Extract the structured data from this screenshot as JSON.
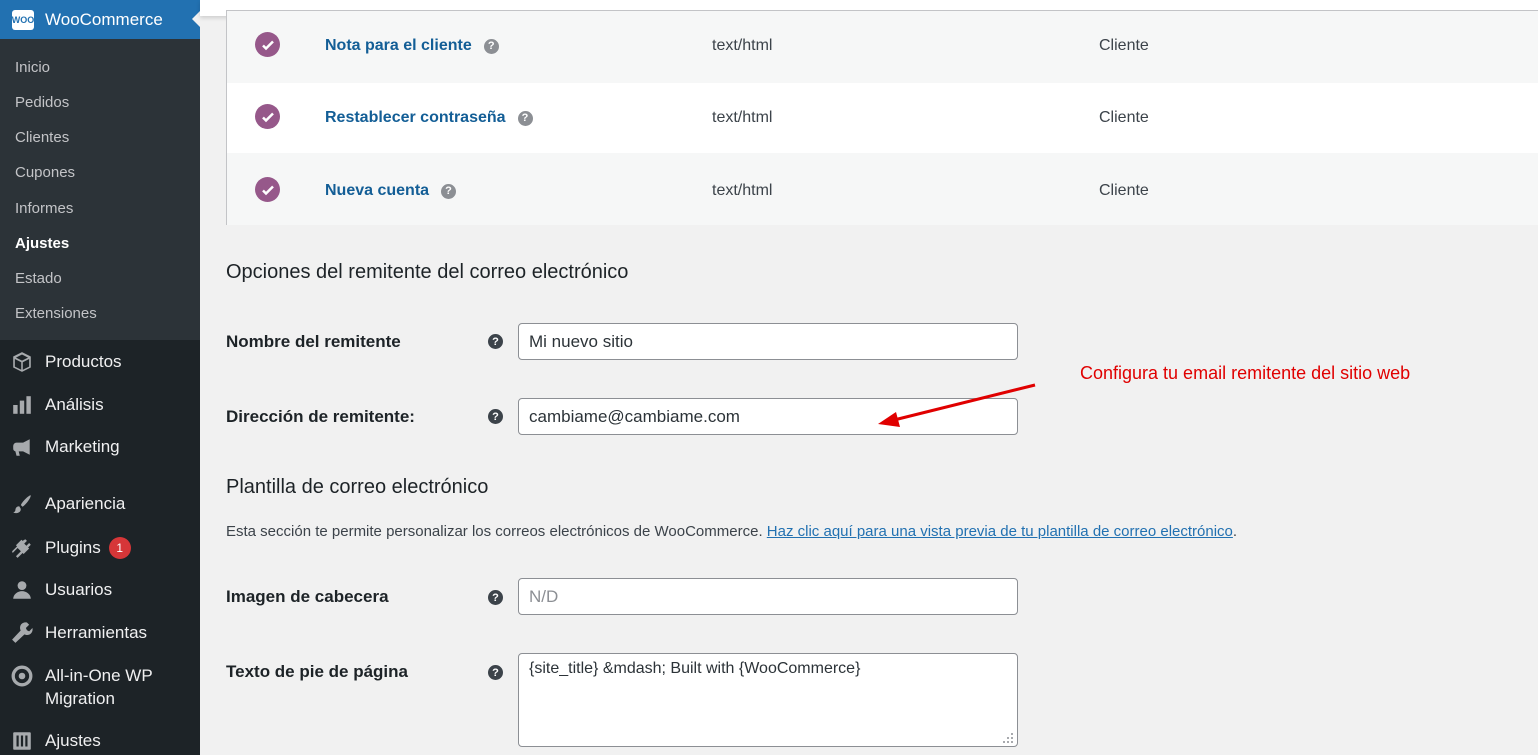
{
  "sidebar": {
    "woo_logo": "WOO",
    "woo_title": "WooCommerce",
    "submenu": [
      "Inicio",
      "Pedidos",
      "Clientes",
      "Cupones",
      "Informes",
      "Ajustes",
      "Estado",
      "Extensiones"
    ],
    "active_submenu": "Ajustes",
    "menu": [
      {
        "label": "Productos",
        "icon": "box-icon"
      },
      {
        "label": "Análisis",
        "icon": "bar-chart-icon"
      },
      {
        "label": "Marketing",
        "icon": "megaphone-icon"
      },
      {
        "label": "Apariencia",
        "icon": "paintbrush-icon"
      },
      {
        "label": "Plugins",
        "icon": "plug-icon",
        "badge": "1"
      },
      {
        "label": "Usuarios",
        "icon": "user-icon"
      },
      {
        "label": "Herramientas",
        "icon": "wrench-icon"
      },
      {
        "label": "All-in-One WP Migration",
        "icon": "migration-icon"
      },
      {
        "label": "Ajustes",
        "icon": "settings-icon"
      }
    ]
  },
  "email_table": {
    "rows": [
      {
        "name": "Nota para el cliente",
        "type": "text/html",
        "recipient": "Cliente",
        "enabled": true
      },
      {
        "name": "Restablecer contraseña",
        "type": "text/html",
        "recipient": "Cliente",
        "enabled": true
      },
      {
        "name": "Nueva cuenta",
        "type": "text/html",
        "recipient": "Cliente",
        "enabled": true
      }
    ]
  },
  "sender_options": {
    "title": "Opciones del remitente del correo electrónico",
    "from_name_label": "Nombre del remitente",
    "from_name_value": "Mi nuevo sitio",
    "from_address_label": "Dirección de remitente:",
    "from_address_value": "cambiame@cambiame.com"
  },
  "template": {
    "title": "Plantilla de correo electrónico",
    "description": "Esta sección te permite personalizar los correos electrónicos de WooCommerce.",
    "preview_link": "Haz clic aquí para una vista previa de tu plantilla de correo electrónico",
    "description_end": ".",
    "header_image_label": "Imagen de cabecera",
    "header_image_placeholder": "N/D",
    "footer_text_label": "Texto de pie de página",
    "footer_text_value": "{site_title} &mdash; Built with {WooCommerce}"
  },
  "annotation": {
    "text": "Configura tu email remitente del sitio web",
    "color": "#e00000"
  },
  "colors": {
    "accent": "#2271b1",
    "woo_purple": "#96588a",
    "link": "#135e96"
  }
}
